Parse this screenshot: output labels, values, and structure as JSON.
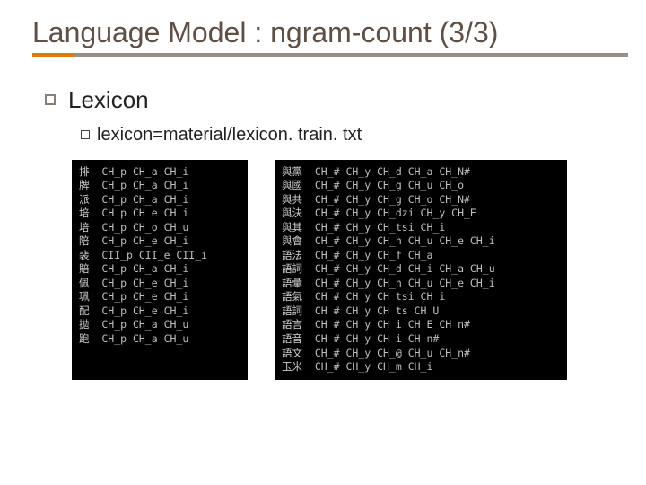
{
  "title": "Language Model : ngram-count (3/3)",
  "section": {
    "heading": "Lexicon",
    "sub": "lexicon=material/lexicon. train. txt"
  },
  "left_panel": [
    {
      "char": "排",
      "phones": "CH_p CH_a CH_i"
    },
    {
      "char": "牌",
      "phones": "CH_p CH_a CH_i"
    },
    {
      "char": "派",
      "phones": "CH_p CH_a CH_i"
    },
    {
      "char": "培",
      "phones": "CH p CH e CH i"
    },
    {
      "char": "培",
      "phones": "CH_p CH_o CH_u"
    },
    {
      "char": "陪",
      "phones": "CH_p CH_e CH_i"
    },
    {
      "char": "裴",
      "phones": "CII_p CII_e CII_i"
    },
    {
      "char": "賠",
      "phones": "CH_p CH_a CH_i"
    },
    {
      "char": "佩",
      "phones": "CH_p CH_e CH_i"
    },
    {
      "char": "珮",
      "phones": "CH_p CH_e CH_i"
    },
    {
      "char": "配",
      "phones": "CH_p CH_e CH_i"
    },
    {
      "char": "拋",
      "phones": "CH_p CH_a CH_u"
    },
    {
      "char": "跑",
      "phones": "CH_p CH_a CH_u"
    }
  ],
  "right_panel": [
    {
      "char": "與黨",
      "phones": "CH_# CH_y CH_d CH_a CH_N#"
    },
    {
      "char": "與國",
      "phones": "CH_# CH_y CH_g CH_u CH_o"
    },
    {
      "char": "與共",
      "phones": "CH_# CH_y CH_g CH_o CH_N#"
    },
    {
      "char": "與決",
      "phones": "CH_# CH_y CH_dzi CH_y CH_E"
    },
    {
      "char": "與其",
      "phones": "CH_# CH_y CH_tsi CH_i"
    },
    {
      "char": "與會",
      "phones": "CH_# CH_y CH_h CH_u CH_e CH_i"
    },
    {
      "char": "語法",
      "phones": "CH_# CH_y CH_f CH_a"
    },
    {
      "char": "語詞",
      "phones": "CH_# CH_y CH_d CH_i CH_a CH_u"
    },
    {
      "char": "語彙",
      "phones": "CH_# CH_y CH_h CH_u CH_e CH_i"
    },
    {
      "char": "語氣",
      "phones": "CH # CH y CH tsi CH i"
    },
    {
      "char": "語詞",
      "phones": "CH # CH y CH ts CH U"
    },
    {
      "char": "語言",
      "phones": "CH # CH y CH i CH E CH n#"
    },
    {
      "char": "語音",
      "phones": "CH # CH y CH i CH n#"
    },
    {
      "char": "語文",
      "phones": "CH_# CH_y CH_@ CH_u CH_n#"
    },
    {
      "char": "玉米",
      "phones": "CH_# CH_y CH_m CH_i"
    }
  ]
}
